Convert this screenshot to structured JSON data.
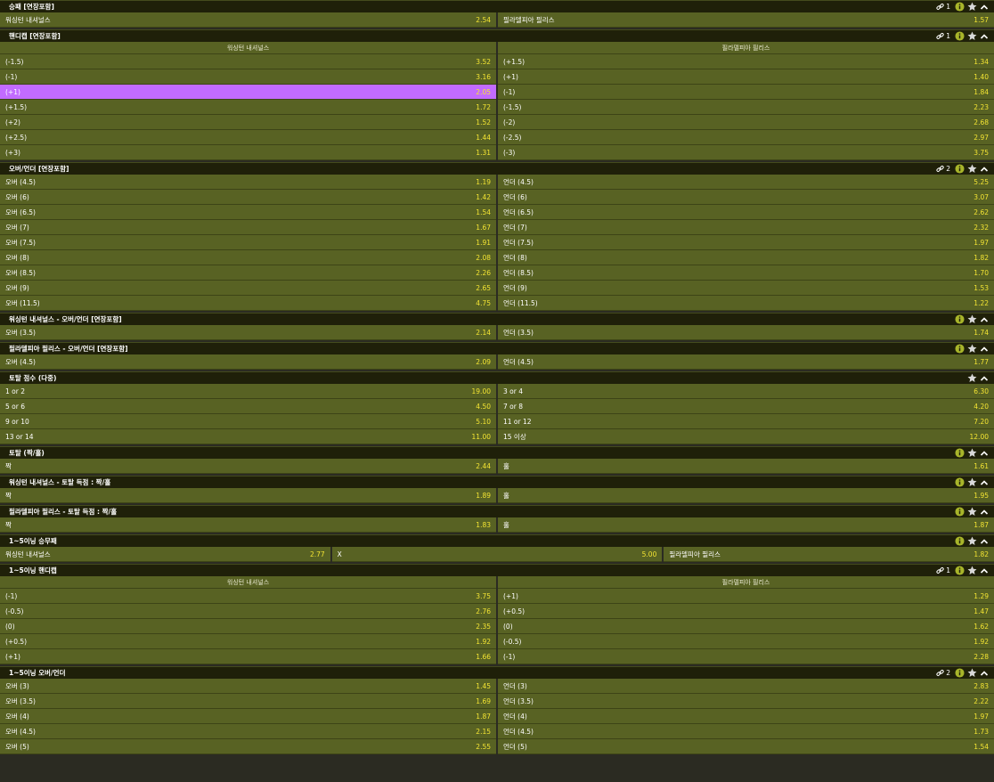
{
  "sections": [
    {
      "title": "승패 [연장포함]",
      "link_count": "1",
      "show_link": true,
      "show_info": true,
      "headers": null,
      "rows": [
        [
          {
            "label": "워싱턴 내셔널스",
            "odd": "2.54"
          },
          {
            "label": "필라델피아 필리스",
            "odd": "1.57"
          }
        ]
      ]
    },
    {
      "title": "핸디캡 [연장포함]",
      "link_count": "1",
      "show_link": true,
      "show_info": true,
      "headers": [
        "워싱턴 내셔널스",
        "필라델피아 필리스"
      ],
      "rows": [
        [
          {
            "label": "(-1.5)",
            "odd": "3.52"
          },
          {
            "label": "(+1.5)",
            "odd": "1.34"
          }
        ],
        [
          {
            "label": "(-1)",
            "odd": "3.16"
          },
          {
            "label": "(+1)",
            "odd": "1.40"
          }
        ],
        [
          {
            "label": "(+1)",
            "odd": "2.05",
            "selected": true
          },
          {
            "label": "(-1)",
            "odd": "1.84"
          }
        ],
        [
          {
            "label": "(+1.5)",
            "odd": "1.72"
          },
          {
            "label": "(-1.5)",
            "odd": "2.23"
          }
        ],
        [
          {
            "label": "(+2)",
            "odd": "1.52"
          },
          {
            "label": "(-2)",
            "odd": "2.68"
          }
        ],
        [
          {
            "label": "(+2.5)",
            "odd": "1.44"
          },
          {
            "label": "(-2.5)",
            "odd": "2.97"
          }
        ],
        [
          {
            "label": "(+3)",
            "odd": "1.31"
          },
          {
            "label": "(-3)",
            "odd": "3.75"
          }
        ]
      ]
    },
    {
      "title": "오버/언더 [연장포함]",
      "link_count": "2",
      "show_link": true,
      "show_info": true,
      "headers": null,
      "rows": [
        [
          {
            "label": "오버 (4.5)",
            "odd": "1.19"
          },
          {
            "label": "언더 (4.5)",
            "odd": "5.25"
          }
        ],
        [
          {
            "label": "오버 (6)",
            "odd": "1.42"
          },
          {
            "label": "언더 (6)",
            "odd": "3.07"
          }
        ],
        [
          {
            "label": "오버 (6.5)",
            "odd": "1.54"
          },
          {
            "label": "언더 (6.5)",
            "odd": "2.62"
          }
        ],
        [
          {
            "label": "오버 (7)",
            "odd": "1.67"
          },
          {
            "label": "언더 (7)",
            "odd": "2.32"
          }
        ],
        [
          {
            "label": "오버 (7.5)",
            "odd": "1.91"
          },
          {
            "label": "언더 (7.5)",
            "odd": "1.97"
          }
        ],
        [
          {
            "label": "오버 (8)",
            "odd": "2.08"
          },
          {
            "label": "언더 (8)",
            "odd": "1.82"
          }
        ],
        [
          {
            "label": "오버 (8.5)",
            "odd": "2.26"
          },
          {
            "label": "언더 (8.5)",
            "odd": "1.70"
          }
        ],
        [
          {
            "label": "오버 (9)",
            "odd": "2.65"
          },
          {
            "label": "언더 (9)",
            "odd": "1.53"
          }
        ],
        [
          {
            "label": "오버 (11.5)",
            "odd": "4.75"
          },
          {
            "label": "언더 (11.5)",
            "odd": "1.22"
          }
        ]
      ]
    },
    {
      "title": "워싱턴 내셔널스 - 오버/언더 [연장포함]",
      "link_count": "",
      "show_link": false,
      "show_info": true,
      "headers": null,
      "rows": [
        [
          {
            "label": "오버 (3.5)",
            "odd": "2.14"
          },
          {
            "label": "언더 (3.5)",
            "odd": "1.74"
          }
        ]
      ]
    },
    {
      "title": "필라델피아 필리스 - 오버/언더 [연장포함]",
      "link_count": "",
      "show_link": false,
      "show_info": true,
      "headers": null,
      "rows": [
        [
          {
            "label": "오버 (4.5)",
            "odd": "2.09"
          },
          {
            "label": "언더 (4.5)",
            "odd": "1.77"
          }
        ]
      ]
    },
    {
      "title": "토탈 점수 (다중)",
      "link_count": "",
      "show_link": false,
      "show_info": false,
      "headers": null,
      "rows": [
        [
          {
            "label": "1 or 2",
            "odd": "19.00"
          },
          {
            "label": "3 or 4",
            "odd": "6.30"
          }
        ],
        [
          {
            "label": "5 or 6",
            "odd": "4.50"
          },
          {
            "label": "7 or 8",
            "odd": "4.20"
          }
        ],
        [
          {
            "label": "9 or 10",
            "odd": "5.10"
          },
          {
            "label": "11 or 12",
            "odd": "7.20"
          }
        ],
        [
          {
            "label": "13 or 14",
            "odd": "11.00"
          },
          {
            "label": "15 이상",
            "odd": "12.00"
          }
        ]
      ]
    },
    {
      "title": "토탈 (짝/홀)",
      "link_count": "",
      "show_link": false,
      "show_info": true,
      "headers": null,
      "rows": [
        [
          {
            "label": "짝",
            "odd": "2.44"
          },
          {
            "label": "홀",
            "odd": "1.61"
          }
        ]
      ]
    },
    {
      "title": "워싱턴 내셔널스 - 토탈 득점 : 짝/홀",
      "link_count": "",
      "show_link": false,
      "show_info": true,
      "headers": null,
      "rows": [
        [
          {
            "label": "짝",
            "odd": "1.89"
          },
          {
            "label": "홀",
            "odd": "1.95"
          }
        ]
      ]
    },
    {
      "title": "필라델피아 필리스 - 토탈 득점 : 짝/홀",
      "link_count": "",
      "show_link": false,
      "show_info": true,
      "headers": null,
      "rows": [
        [
          {
            "label": "짝",
            "odd": "1.83"
          },
          {
            "label": "홀",
            "odd": "1.87"
          }
        ]
      ]
    },
    {
      "title": "1~5이닝 승무패",
      "link_count": "",
      "show_link": false,
      "show_info": true,
      "headers": null,
      "rows": [
        [
          {
            "label": "워싱턴 내셔널스",
            "odd": "2.77"
          },
          {
            "label": "X",
            "odd": "5.00"
          },
          {
            "label": "필라델피아 필리스",
            "odd": "1.82"
          }
        ]
      ]
    },
    {
      "title": "1~5이닝 핸디캡",
      "link_count": "1",
      "show_link": true,
      "show_info": true,
      "headers": [
        "워싱턴 내셔널스",
        "필라델피아 필리스"
      ],
      "rows": [
        [
          {
            "label": "(-1)",
            "odd": "3.75"
          },
          {
            "label": "(+1)",
            "odd": "1.29"
          }
        ],
        [
          {
            "label": "(-0.5)",
            "odd": "2.76"
          },
          {
            "label": "(+0.5)",
            "odd": "1.47"
          }
        ],
        [
          {
            "label": "(0)",
            "odd": "2.35"
          },
          {
            "label": "(0)",
            "odd": "1.62"
          }
        ],
        [
          {
            "label": "(+0.5)",
            "odd": "1.92"
          },
          {
            "label": "(-0.5)",
            "odd": "1.92"
          }
        ],
        [
          {
            "label": "(+1)",
            "odd": "1.66"
          },
          {
            "label": "(-1)",
            "odd": "2.28"
          }
        ]
      ]
    },
    {
      "title": "1~5이닝 오버/언더",
      "link_count": "2",
      "show_link": true,
      "show_info": true,
      "headers": null,
      "rows": [
        [
          {
            "label": "오버 (3)",
            "odd": "1.45"
          },
          {
            "label": "언더 (3)",
            "odd": "2.83"
          }
        ],
        [
          {
            "label": "오버 (3.5)",
            "odd": "1.69"
          },
          {
            "label": "언더 (3.5)",
            "odd": "2.22"
          }
        ],
        [
          {
            "label": "오버 (4)",
            "odd": "1.87"
          },
          {
            "label": "언더 (4)",
            "odd": "1.97"
          }
        ],
        [
          {
            "label": "오버 (4.5)",
            "odd": "2.15"
          },
          {
            "label": "언더 (4.5)",
            "odd": "1.73"
          }
        ],
        [
          {
            "label": "오버 (5)",
            "odd": "2.55"
          },
          {
            "label": "언더 (5)",
            "odd": "1.54"
          }
        ]
      ]
    }
  ],
  "icons": {
    "link": "link-icon",
    "info": "info-icon",
    "favorite": "star-icon",
    "collapse": "chevron-up-icon"
  },
  "colors": {
    "page_bg": "#2b2b22",
    "header_bg": "#1f2009",
    "cell_bg": "#586223",
    "odd_text": "#f3e433",
    "selected_bg": "#c26bff",
    "info_icon": "#a8b52a"
  }
}
